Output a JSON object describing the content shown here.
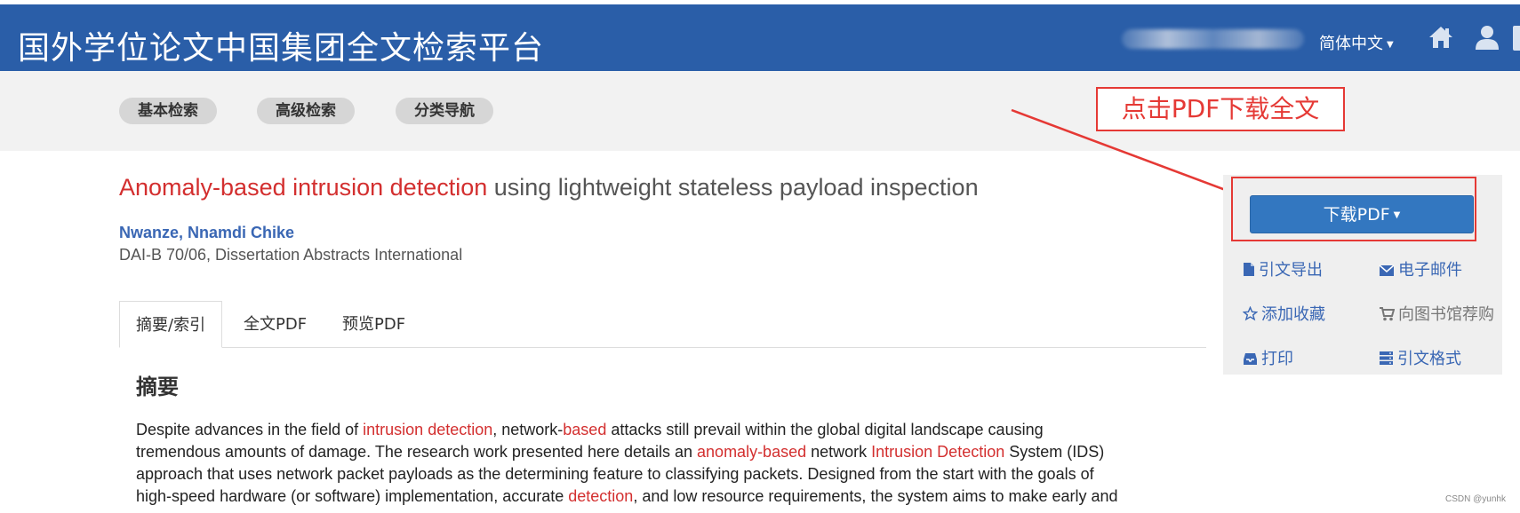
{
  "header": {
    "site_title": "国外学位论文中国集团全文检索平台",
    "language": "简体中文",
    "home_icon": "home-icon",
    "user_icon": "user-icon"
  },
  "nav": {
    "basic_search": "基本检索",
    "advanced_search": "高级检索",
    "category_nav": "分类导航"
  },
  "annotation": {
    "text": "点击PDF下载全文",
    "color": "#e53935"
  },
  "article": {
    "title_highlight": "Anomaly-based intrusion detection",
    "title_rest": " using lightweight stateless payload inspection",
    "author": "Nwanze, Nnamdi Chike",
    "source": "DAI-B 70/06, Dissertation Abstracts International"
  },
  "tabs": {
    "abstract": "摘要/索引",
    "full_pdf": "全文PDF",
    "preview_pdf": "预览PDF"
  },
  "abstract": {
    "heading": "摘要",
    "l1_a": "Despite advances in the field of ",
    "l1_hl1": "intrusion detection",
    "l1_b": ", network-",
    "l1_hl2": "based",
    "l1_c": " attacks still prevail within the global digital landscape causing",
    "l2_a": "tremendous amounts of damage. The research work presented here details an ",
    "l2_hl1": "anomaly-based",
    "l2_b": " network ",
    "l2_hl2": "Intrusion Detection",
    "l2_c": " System (IDS)",
    "l3": "approach that uses network packet payloads as the determining feature to classifying packets. Designed from the start with the goals of",
    "l4_a": "high-speed hardware (or software) implementation, accurate ",
    "l4_hl": "detection",
    "l4_b": ", and low resource requirements, the system aims to make early and"
  },
  "sidebar": {
    "download_button": "下载PDF",
    "export_citation": "引文导出",
    "email": "电子邮件",
    "add_favorite": "添加收藏",
    "recommend_library": "向图书馆荐购",
    "print": "打印",
    "citation_format": "引文格式"
  },
  "watermark": "CSDN @yunhk",
  "colors": {
    "header_bg": "#2a5ea8",
    "link": "#3a67b4",
    "highlight": "#d32f2f",
    "button": "#3377c0"
  }
}
